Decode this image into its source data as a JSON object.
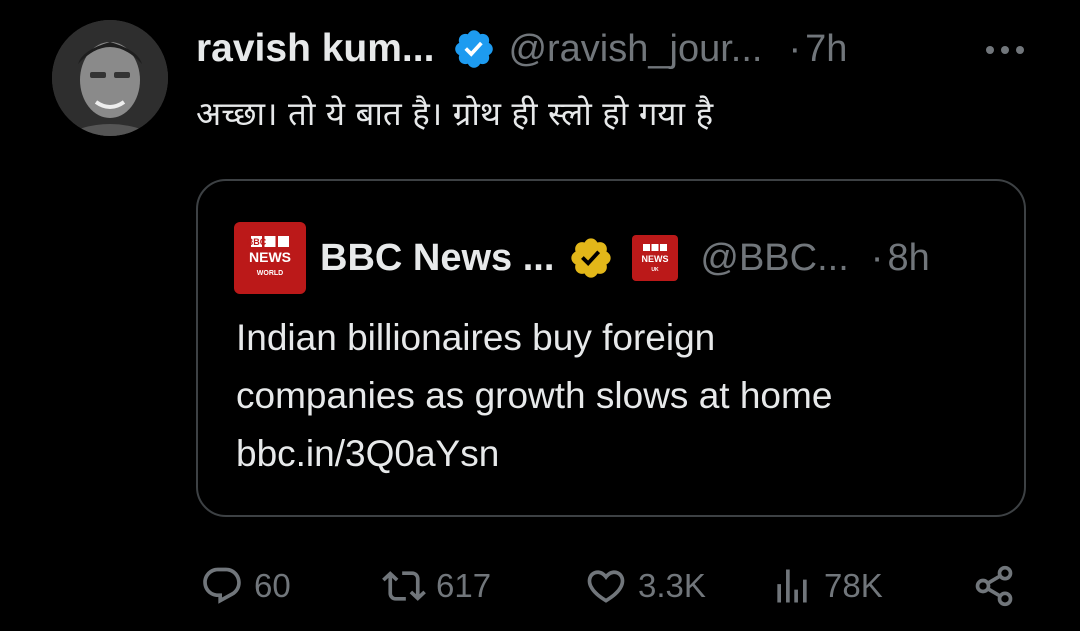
{
  "tweet": {
    "author_name": "ravish kum...",
    "author_handle": "@ravish_jour...",
    "separator": "·",
    "time": "7h",
    "text": "अच्छा। तो ये बात है। ग्रोथ ही स्लो हो गया है"
  },
  "quoted": {
    "author_name": "BBC News ...",
    "author_handle": "@BBC...",
    "separator": "·",
    "time": "8h",
    "text_lines": [
      "Indian billionaires buy foreign",
      "companies as growth slows at home",
      "bbc.in/3Q0aYsn"
    ],
    "logo": {
      "line1": "BBC",
      "line2": "NEWS",
      "line3": "WORLD"
    },
    "affiliate_logo": {
      "line1": "BBC",
      "line2": "NEWS",
      "line3": "UK"
    }
  },
  "actions": {
    "replies": "60",
    "reposts": "617",
    "likes": "3.3K",
    "views": "78K"
  },
  "icons": [
    "avatar",
    "verified-blue-icon",
    "more-icon",
    "verified-gold-icon",
    "reply-icon",
    "repost-icon",
    "like-icon",
    "views-icon",
    "share-icon"
  ],
  "colors": {
    "background": "#000000",
    "text_primary": "#e7e9ea",
    "text_secondary": "#71767b",
    "verified_blue": "#1d9bf0",
    "verified_gold": "#e2b719",
    "bbc_red": "#bb1919",
    "border": "#3d4144"
  }
}
